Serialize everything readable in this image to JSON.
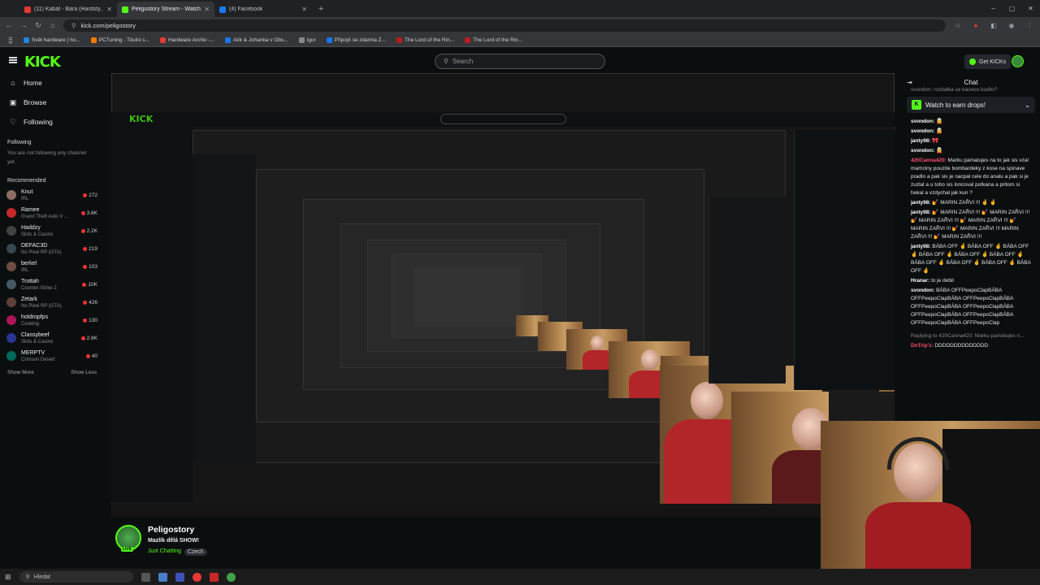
{
  "browser": {
    "tabs": [
      {
        "title": "(11) Kabát - Bára (Hardsty...",
        "fav": "#e53935",
        "active": false
      },
      {
        "title": "Peligostory Stream - Watch Li...",
        "fav": "#53fc18",
        "active": true
      },
      {
        "title": "(4) Facebook",
        "fav": "#1877f2",
        "active": false
      }
    ],
    "url": "kick.com/peligostory",
    "bookmarks": [
      {
        "label": "Svět hardware | ho...",
        "color": "#1e88e5"
      },
      {
        "label": "PCTuning - Titulní s...",
        "color": "#f57c00"
      },
      {
        "label": "Hardware Archiv -...",
        "color": "#e53935"
      },
      {
        "label": "Alík & Johanka v Obs...",
        "color": "#1877f2"
      },
      {
        "label": "Igor",
        "color": "#888888"
      },
      {
        "label": "Připojit se zdarma Z...",
        "color": "#1877f2"
      },
      {
        "label": "The Lord of the Rin...",
        "color": "#b71c1c"
      },
      {
        "label": "The Lord of the Rin...",
        "color": "#b71c1c"
      }
    ]
  },
  "header": {
    "logo": "KICK",
    "search_placeholder": "Search",
    "get_kicks": "Get KICKs"
  },
  "sidebar": {
    "nav": [
      {
        "label": "Home",
        "icon": "⌂"
      },
      {
        "label": "Browse",
        "icon": "▣"
      },
      {
        "label": "Following",
        "icon": "♡"
      }
    ],
    "following_heading": "Following",
    "following_note": "You are not following any channel yet.",
    "recommended_heading": "Recommended",
    "channels": [
      {
        "name": "Knut",
        "category": "IRL",
        "viewers": "272",
        "color": "#8d6e63"
      },
      {
        "name": "Ramee",
        "category": "Grand Theft Auto V ...",
        "viewers": "3.6K",
        "color": "#c62828"
      },
      {
        "name": "Haddzy",
        "category": "Slots & Casino",
        "viewers": "2.2K",
        "color": "#424242"
      },
      {
        "name": "DEFAC3D",
        "category": "No Pixel RP (GTA)",
        "viewers": "219",
        "color": "#37474f"
      },
      {
        "name": "berkel",
        "category": "IRL",
        "viewers": "103",
        "color": "#6d4c41"
      },
      {
        "name": "Trottah",
        "category": "Counter-Strike 2",
        "viewers": "10K",
        "color": "#455a64"
      },
      {
        "name": "Zetark",
        "category": "No Pixel RP (GTA)",
        "viewers": "426",
        "color": "#5d4037"
      },
      {
        "name": "hotdropfps",
        "category": "Cooking",
        "viewers": "130",
        "color": "#ad1457"
      },
      {
        "name": "Classybeef",
        "category": "Slots & Casino",
        "viewers": "2.8K",
        "color": "#283593"
      },
      {
        "name": "MERPTV",
        "category": "Crimson Desert",
        "viewers": "40",
        "color": "#00695c"
      }
    ],
    "show_more": "Show More",
    "show_less": "Show Less"
  },
  "stream": {
    "streamer": "Peligostory",
    "title": "Mazlík dělá SHOW!",
    "category": "Just Chatting",
    "language": "Czech",
    "live_badge": "LIVE"
  },
  "chat": {
    "header": "Chat",
    "drops_banner": "Watch to earn drops!",
    "top_fragment": "svondon: rozbalka se kaceou buďto?",
    "messages": [
      {
        "user": "svondon:",
        "color": "#ffffff",
        "text": "🧝"
      },
      {
        "user": "svondon:",
        "color": "#ffffff",
        "text": "🧝"
      },
      {
        "user": "janty98:",
        "color": "#ffffff",
        "text": "🎀"
      },
      {
        "user": "svondon:",
        "color": "#ffffff",
        "text": "🧝"
      },
      {
        "user": "420Canna420:",
        "color": "#ff4d6d",
        "text": "Marku pamatujes na to jak sis vzal mamciny pouzite bombardeky z kose na spinave pradlo a pak sis je nacpal cele do analu a pak si je zuzlal a u toho sis loncoval potkana a pritom si hekal a vzdychal jak kun ?"
      },
      {
        "user": "janty98:",
        "color": "#ffffff",
        "text": "💅 MARIN ZAŘVI !!! 🤞 🤞"
      },
      {
        "user": "janty98:",
        "color": "#ffffff",
        "text": "💅 MARIN ZAŘVI !!! 💅 MARIN ZAŘVI !!! 💅 MARIN ZAŘVI !!! 💅 MARIN ZAŘVI !!! 💅 MARIN ZAŘVI !!! 💅 MARIN ZAŘVI !!! MARIN ZAŘVI !!! 💅 MARIN ZAŘVI !!!"
      },
      {
        "user": "janty98:",
        "color": "#ffffff",
        "text": "BÁBA OFF 🤞 BÁBA OFF 🤞 BÁBA OFF 🤞 BÁBA OFF 🤞 BÁBA OFF 🤞 BÁBA OFF 🤞 BÁBA OFF 🤞 BÁBA OFF 🤞 BÁBA OFF 🤞 BÁBA OFF 🤞"
      },
      {
        "user": "Hranar:",
        "color": "#ffffff",
        "text": "to je debil"
      },
      {
        "user": "svondon:",
        "color": "#ffffff",
        "text": "BÁBA OFFPeepoClapBÁBA OFFPeepoClapBÁBA OFFPeepoClapBÁBA OFFPeepoClapBÁBA OFFPeepoClapBÁBA OFFPeepoClapBÁBA OFFPeepoClapBÁBA OFFPeepoClapBÁBA OFFPeepoClap"
      }
    ],
    "reply_note": "Replying to 420Canna420: Marku pamatujes n...",
    "reply_user": "DnTrip'z:",
    "reply_text": "DDDDDDDDDDDDDD"
  },
  "taskbar": {
    "search_placeholder": "Hledat"
  }
}
